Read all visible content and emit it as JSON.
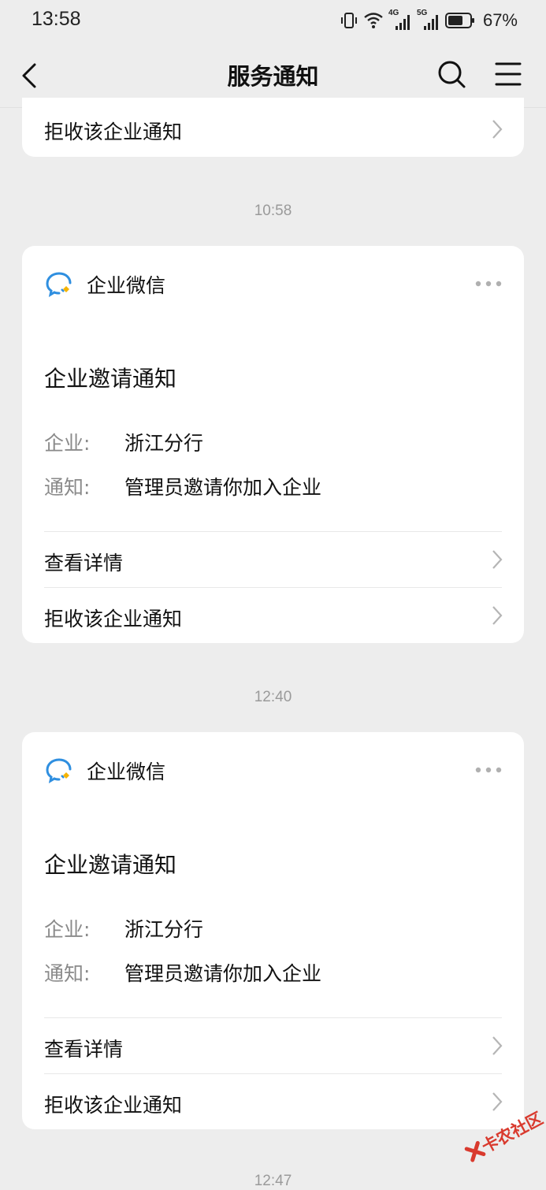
{
  "status_bar": {
    "time": "13:58",
    "battery_percent": "67%",
    "network_1": "4G",
    "network_2": "5G"
  },
  "nav": {
    "title": "服务通知"
  },
  "partial_card": {
    "reject_label": "拒收该企业通知"
  },
  "messages": [
    {
      "timestamp": "10:58",
      "app_name": "企业微信",
      "title": "企业邀请通知",
      "company_label": "企业:",
      "company_value": "浙江分行",
      "notice_label": "通知:",
      "notice_value": "管理员邀请你加入企业",
      "view_details_label": "查看详情",
      "reject_label": "拒收该企业通知"
    },
    {
      "timestamp": "12:40",
      "app_name": "企业微信",
      "title": "企业邀请通知",
      "company_label": "企业:",
      "company_value": "浙江分行",
      "notice_label": "通知:",
      "notice_value": "管理员邀请你加入企业",
      "view_details_label": "查看详情",
      "reject_label": "拒收该企业通知"
    }
  ],
  "next_timestamp": "12:47",
  "watermark": "卡农社区",
  "colors": {
    "background": "#ededed",
    "card": "#ffffff",
    "muted_text": "#8a8a8a",
    "timestamp": "#9a9a9a",
    "logo_blue": "#2f8fe0",
    "logo_yellow": "#f5b400",
    "watermark_red": "#d93a2e"
  },
  "icons": [
    "back-arrow-icon",
    "search-icon",
    "menu-icon",
    "chevron-right-icon",
    "more-dots-icon",
    "wecom-logo-icon"
  ]
}
